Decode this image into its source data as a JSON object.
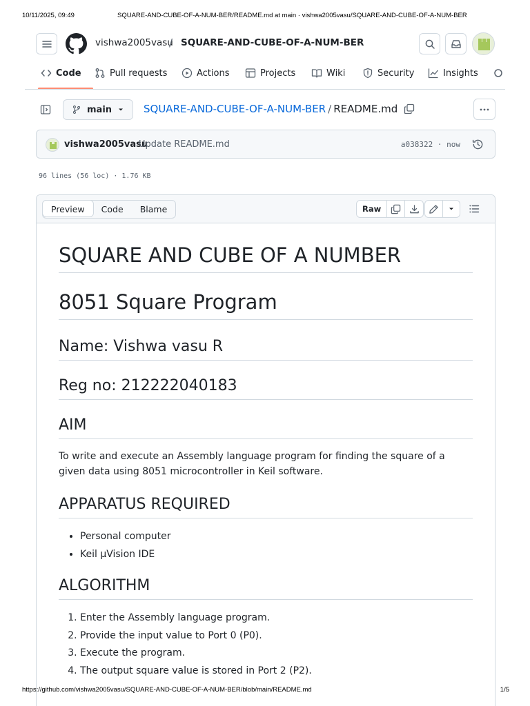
{
  "print": {
    "date": "10/11/2025, 09:49",
    "title": "SQUARE-AND-CUBE-OF-A-NUM-BER/README.md at main · vishwa2005vasu/SQUARE-AND-CUBE-OF-A-NUM-BER",
    "url": "https://github.com/vishwa2005vasu/SQUARE-AND-CUBE-OF-A-NUM-BER/blob/main/README.md",
    "page": "1/5"
  },
  "header": {
    "owner": "vishwa2005vasu",
    "separator": "/",
    "repo": "SQUARE-AND-CUBE-OF-A-NUM-BER"
  },
  "nav": {
    "items": [
      {
        "label": "Code",
        "icon": "code-icon"
      },
      {
        "label": "Pull requests",
        "icon": "pull-request-icon"
      },
      {
        "label": "Actions",
        "icon": "play-icon"
      },
      {
        "label": "Projects",
        "icon": "table-icon"
      },
      {
        "label": "Wiki",
        "icon": "book-icon"
      },
      {
        "label": "Security",
        "icon": "shield-icon"
      },
      {
        "label": "Insights",
        "icon": "graph-icon"
      }
    ]
  },
  "file": {
    "branch": "main",
    "path_repo": "SQUARE-AND-CUBE-OF-A-NUM-BER",
    "path_sep": "/",
    "filename": "README.md"
  },
  "commit": {
    "author": "vishwa2005vasu",
    "message": "Update README.md",
    "sha_time": "a038322 · now"
  },
  "meta": "96 lines (56 loc) · 1.76 KB",
  "toolbar": {
    "tabs": [
      "Preview",
      "Code",
      "Blame"
    ],
    "raw": "Raw"
  },
  "readme": {
    "h1_title": "SQUARE AND CUBE OF A NUMBER",
    "h1_program": "8051 Square Program",
    "name": "Name: Vishwa vasu R",
    "reg": "Reg no: 212222040183",
    "aim_heading": "AIM",
    "aim_text": "To write and execute an Assembly language program for finding the square of a given data using 8051 microcontroller in Keil software.",
    "apparatus_heading": "APPARATUS REQUIRED",
    "apparatus": [
      "Personal computer",
      "Keil µVision IDE"
    ],
    "algorithm_heading": "ALGORITHM",
    "algorithm": [
      "Enter the Assembly language program.",
      "Provide the input value to Port 0 (P0).",
      "Execute the program.",
      "The output square value is stored in Port 2 (P2)."
    ]
  }
}
